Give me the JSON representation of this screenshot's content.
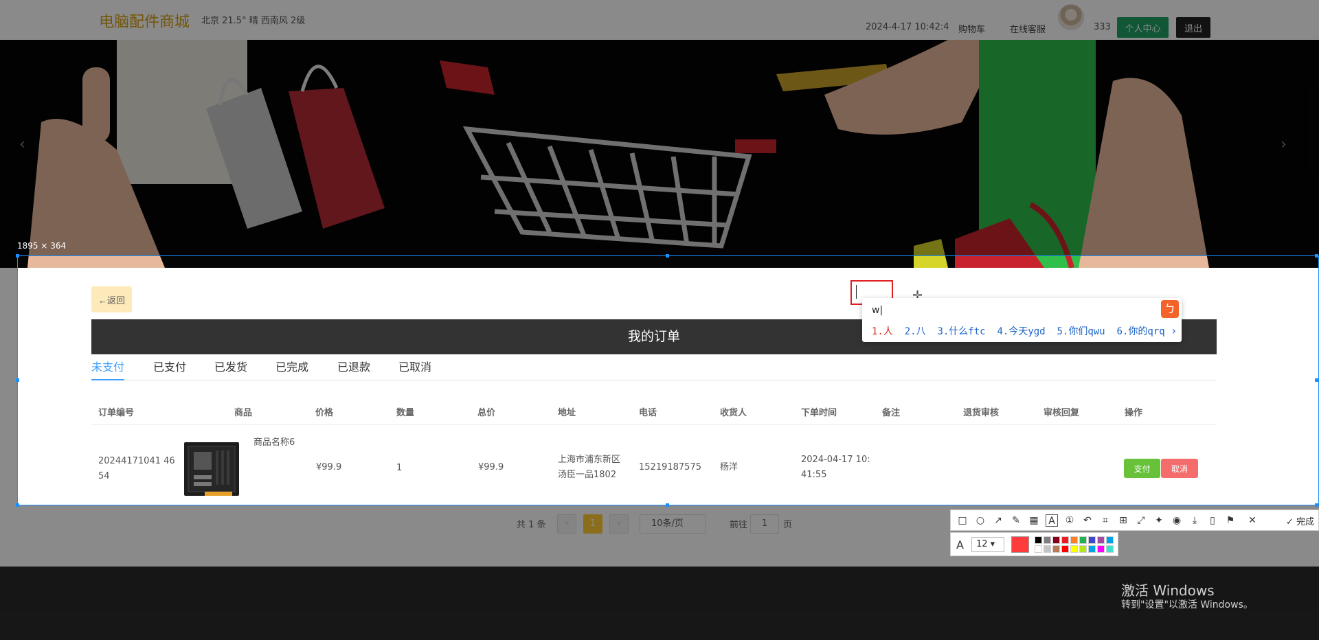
{
  "header": {
    "logo": "电脑配件商城",
    "weather": "北京  21.5°  晴  西南风  2级",
    "datetime": "2024-4-17 10:42:4",
    "cart": "购物车",
    "service": "在线客服",
    "username": "333",
    "user_center": "个人中心",
    "logout": "退出"
  },
  "banner": {
    "left_arrow": "‹",
    "right_arrow": "›"
  },
  "orders": {
    "back_label": "←返回",
    "title": "我的订单",
    "tabs": [
      "未支付",
      "已支付",
      "已发货",
      "已完成",
      "已退款",
      "已取消"
    ],
    "active_tab": "未支付",
    "columns": [
      "订单编号",
      "商品",
      "价格",
      "数量",
      "总价",
      "地址",
      "电话",
      "收货人",
      "下单时间",
      "备注",
      "退货审核",
      "审核回复",
      "操作"
    ],
    "rows": [
      {
        "order_no_1": "20244171041 46",
        "order_no_2": "54",
        "product_name": "商品名称6",
        "price": "¥99.9",
        "quantity": "1",
        "total": "¥99.9",
        "address_1": "上海市浦东新区",
        "address_2": "汤臣一品1802",
        "phone": "15219187575",
        "receiver": "杨洋",
        "time_1": "2024-04-17 10:",
        "time_2": "41:55",
        "pay_label": "支付",
        "cancel_label": "取消"
      }
    ]
  },
  "pagination": {
    "total": "共 1 条",
    "prev": "‹",
    "current_page": "1",
    "next": "›",
    "page_size": "10条/页",
    "goto": "前往",
    "goto_value": "1",
    "page_unit": "页"
  },
  "screenshot_tool": {
    "selection_size": "1895 × 364",
    "ime_composition": "w|",
    "ime_candidates": [
      "1.人",
      "2.八",
      "3.什么ftc",
      "4.今天ygd",
      "5.你们qwu",
      "6.你的qrq"
    ],
    "font_size": "12",
    "done_label": "完成",
    "current_color": "#ff3b3b",
    "palette": [
      "#000000",
      "#7f7f7f",
      "#880015",
      "#ed1c24",
      "#ff7f27",
      "#22b14c",
      "#3f48cc",
      "#a349a4",
      "#00a2e8",
      "#ffffff",
      "#c3c3c3",
      "#b97a57",
      "#ff0000",
      "#ffff00",
      "#b5e61d",
      "#00a2e8",
      "#ff00ff",
      "#40e0d0"
    ]
  },
  "windows_activation": {
    "line1": "激活 Windows",
    "line2": "转到\"设置\"以激活 Windows。"
  },
  "colors": {
    "accent_tab": "#409eff",
    "user_center_button": "#20a162",
    "pay_button": "#67c23a",
    "cancel_button": "#f56c6c",
    "back_button": "#fdeabb",
    "title_bar": "#333333"
  }
}
